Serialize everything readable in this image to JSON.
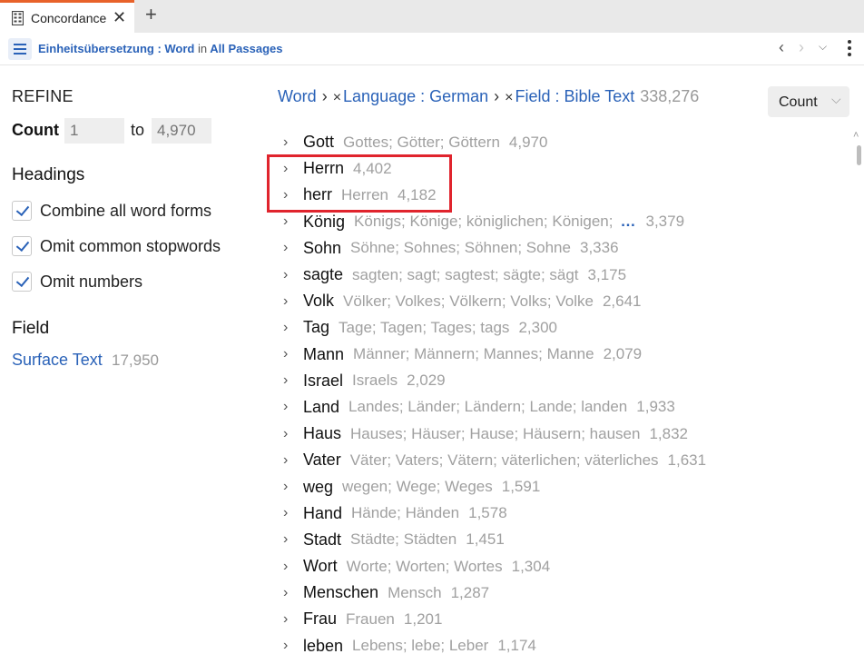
{
  "tab": {
    "title": "Concordance",
    "close": "✕",
    "add": "+"
  },
  "toolbar": {
    "resource": "Einheitsübersetzung : Word",
    "connector": "in",
    "scope": "All Passages"
  },
  "refine": {
    "title": "REFINE",
    "count_label": "Count",
    "count_from_placeholder": "1",
    "count_to_label": "to",
    "count_to_placeholder": "4,970",
    "headings_title": "Headings",
    "options": [
      {
        "label": "Combine all word forms",
        "checked": true
      },
      {
        "label": "Omit common stopwords",
        "checked": true
      },
      {
        "label": "Omit numbers",
        "checked": true
      }
    ],
    "field_title": "Field",
    "field_link": "Surface Text",
    "field_count": "17,950"
  },
  "filters": {
    "root": "Word",
    "sep": "›",
    "remove": "×",
    "language": "Language : German",
    "field": "Field : Bible Text",
    "total": "338,276"
  },
  "sort": {
    "label": "Count"
  },
  "results": [
    {
      "word": "Gott",
      "forms": "Gottes; Götter; Göttern",
      "count": "4,970"
    },
    {
      "word": "Herrn",
      "forms": "",
      "count": "4,402"
    },
    {
      "word": "herr",
      "forms": "Herren",
      "count": "4,182"
    },
    {
      "word": "König",
      "forms": "Königs; Könige; königlichen; Königen;",
      "more": "…",
      "count": "3,379"
    },
    {
      "word": "Sohn",
      "forms": "Söhne; Sohnes; Söhnen; Sohne",
      "count": "3,336"
    },
    {
      "word": "sagte",
      "forms": "sagten; sagt; sagtest; sägte; sägt",
      "count": "3,175"
    },
    {
      "word": "Volk",
      "forms": "Völker; Volkes; Völkern; Volks; Volke",
      "count": "2,641"
    },
    {
      "word": "Tag",
      "forms": "Tage; Tagen; Tages; tags",
      "count": "2,300"
    },
    {
      "word": "Mann",
      "forms": "Männer; Männern; Mannes; Manne",
      "count": "2,079"
    },
    {
      "word": "Israel",
      "forms": "Israels",
      "count": "2,029"
    },
    {
      "word": "Land",
      "forms": "Landes; Länder; Ländern; Lande; landen",
      "count": "1,933"
    },
    {
      "word": "Haus",
      "forms": "Hauses; Häuser; Hause; Häusern; hausen",
      "count": "1,832"
    },
    {
      "word": "Vater",
      "forms": "Väter; Vaters; Vätern; väterlichen; väterliches",
      "count": "1,631"
    },
    {
      "word": "weg",
      "forms": "wegen; Wege; Weges",
      "count": "1,591"
    },
    {
      "word": "Hand",
      "forms": "Hände; Händen",
      "count": "1,578"
    },
    {
      "word": "Stadt",
      "forms": "Städte; Städten",
      "count": "1,451"
    },
    {
      "word": "Wort",
      "forms": "Worte; Worten; Wortes",
      "count": "1,304"
    },
    {
      "word": "Menschen",
      "forms": "Mensch",
      "count": "1,287"
    },
    {
      "word": "Frau",
      "forms": "Frauen",
      "count": "1,201"
    },
    {
      "word": "leben",
      "forms": "Lebens; lebe; Leber",
      "count": "1,174"
    }
  ],
  "colors": {
    "accent": "#2a62b8",
    "tab_accent": "#e8622a",
    "highlight": "#e0242d"
  }
}
